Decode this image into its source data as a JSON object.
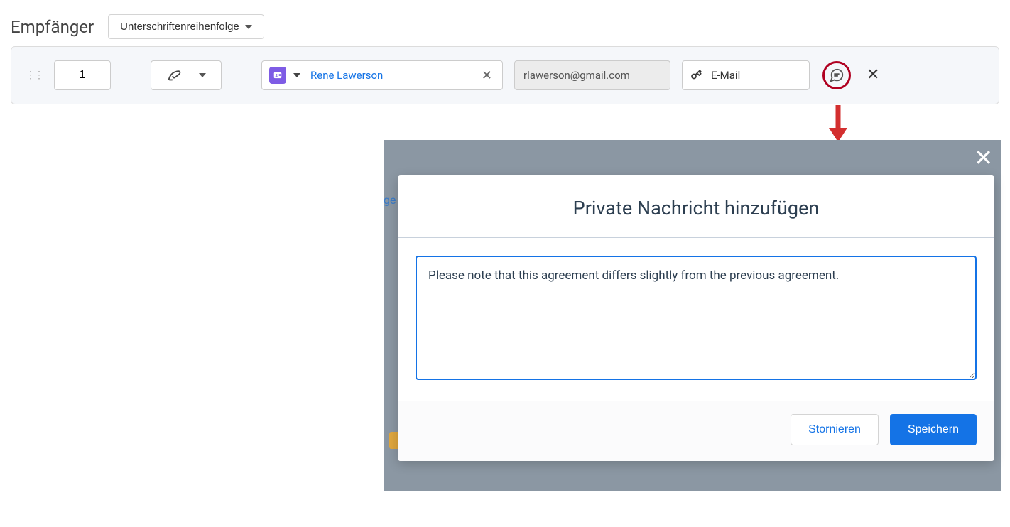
{
  "section": {
    "title": "Empfänger",
    "signature_order_btn": "Unterschriftenreihenfolge"
  },
  "recipient": {
    "order": "1",
    "name": "Rene Lawerson",
    "email": "rlawerson@gmail.com",
    "verify_method": "E-Mail"
  },
  "modal": {
    "title": "Private Nachricht hinzufügen",
    "message": "Please note that this agreement differs slightly from the previous agreement.",
    "cancel": "Stornieren",
    "save": "Speichern"
  },
  "partial_text": "ge"
}
